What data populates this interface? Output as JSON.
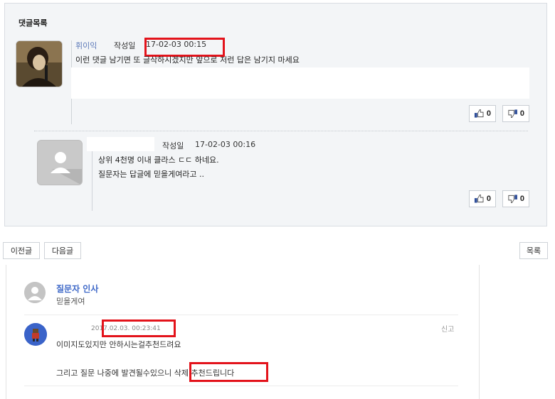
{
  "comments": {
    "title": "댓글목록",
    "items": [
      {
        "author": "휘이익",
        "date_label": "작성일",
        "date": "17-02-03 00:15",
        "text": "이런 댓글 남기면 또 글삭하시겠지만 앞으로 저런 답은 남기지 마세요",
        "up": "0",
        "down": "0"
      },
      {
        "date_label": "작성일",
        "date": "17-02-03 00:16",
        "line1": "상위 4천명 이내 클라스 ㄷㄷ 하네요.",
        "line2": "질문자는 답글에 믿을게여라고 ..",
        "up": "0",
        "down": "0"
      }
    ]
  },
  "nav": {
    "prev": "이전글",
    "next": "다음글",
    "list": "목록"
  },
  "qa": {
    "greeting_title": "질문자 인사",
    "greeting_text": "믿을게여",
    "answer": {
      "date": "2017.02.03. 00:23:41",
      "report": "신고",
      "line1": "이미지도있지만 안하시는걸추천드려요",
      "line2": "그리고 질문 나중에 발견될수있으니 삭제 추천드립니다"
    }
  },
  "colors": {
    "highlight": "#e3131b",
    "link": "#3f69c8",
    "panel_bg": "#f3f5f7"
  }
}
